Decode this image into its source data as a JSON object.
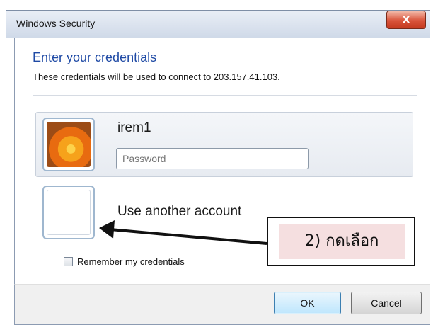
{
  "window": {
    "title": "Windows Security",
    "close_label": "x"
  },
  "dialog": {
    "header": "Enter your credentials",
    "subtext": "These credentials will be used to connect to 203.157.41.103."
  },
  "account": {
    "username": "irem1",
    "password_placeholder": "Password"
  },
  "another_account": {
    "label": "Use another account"
  },
  "remember": {
    "label": "Remember my credentials",
    "checked": false
  },
  "buttons": {
    "ok": "OK",
    "cancel": "Cancel"
  },
  "annotation": {
    "text": "2) กดเลือก"
  },
  "icons": {
    "close": "close-icon",
    "avatar": "flower-avatar",
    "checkbox": "checkbox-icon",
    "arrow": "arrow-left-icon"
  },
  "colors": {
    "header": "#1f4aa5",
    "close_button": "#d9533a",
    "annotation_bg": "#f5dfe0"
  }
}
